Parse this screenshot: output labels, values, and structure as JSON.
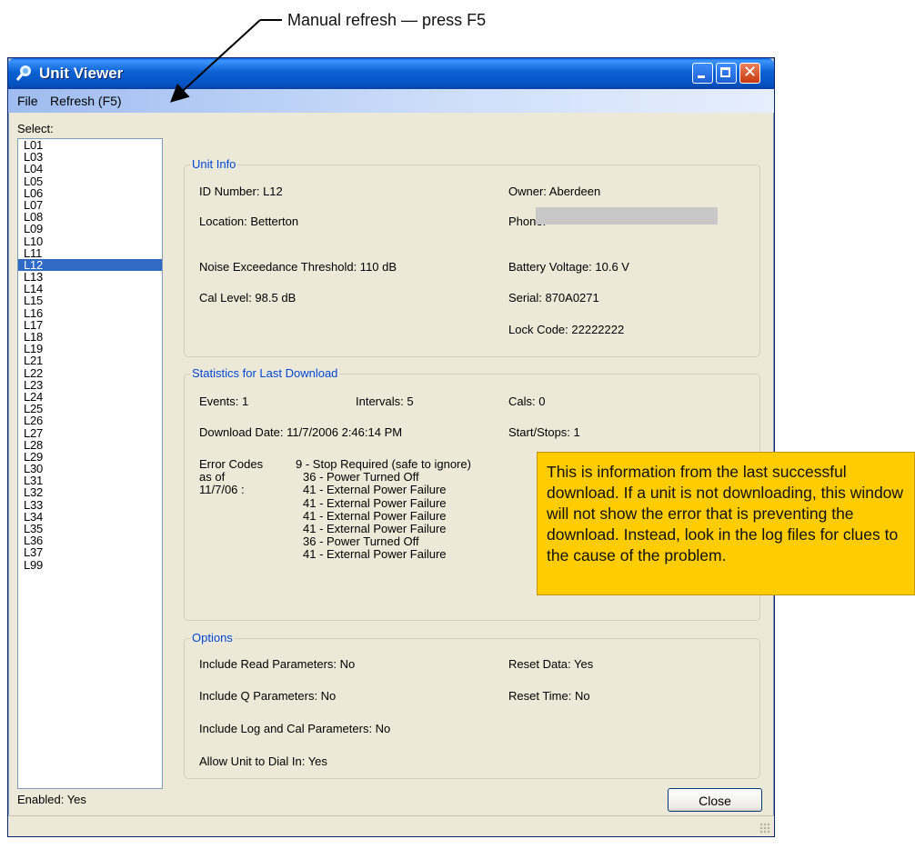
{
  "callout": {
    "text": "Manual refresh — press F5"
  },
  "window": {
    "title": "Unit Viewer"
  },
  "menu": {
    "file": "File",
    "refresh": "Refresh (F5)"
  },
  "select_label": "Select:",
  "units": [
    "L01",
    "L03",
    "L04",
    "L05",
    "L06",
    "L07",
    "L08",
    "L09",
    "L10",
    "L11",
    "L12",
    "L13",
    "L14",
    "L15",
    "L16",
    "L17",
    "L18",
    "L19",
    "L21",
    "L22",
    "L23",
    "L24",
    "L25",
    "L26",
    "L27",
    "L28",
    "L29",
    "L30",
    "L31",
    "L32",
    "L33",
    "L34",
    "L35",
    "L36",
    "L37",
    "L99"
  ],
  "selected_unit": "L12",
  "enabled": "Enabled: Yes",
  "unit_info": {
    "title": "Unit Info",
    "id_number": "ID Number: L12",
    "owner": "Owner: Aberdeen",
    "location": "Location: Betterton",
    "phone": "Phone:",
    "noise_threshold": "Noise Exceedance Threshold: 110 dB",
    "battery": "Battery Voltage: 10.6 V",
    "cal_level": "Cal Level: 98.5 dB",
    "serial": "Serial: 870A0271",
    "lock_code": "Lock Code: 22222222"
  },
  "stats": {
    "title": "Statistics for Last Download",
    "events": "Events: 1",
    "intervals": "Intervals: 5",
    "cals": "Cals: 0",
    "download_date": "Download Date: 11/7/2006 2:46:14 PM",
    "start_stops": "Start/Stops: 1",
    "error_codes_label": [
      "Error Codes",
      "as of",
      "11/7/06 :"
    ],
    "error_codes": [
      "9 - Stop Required (safe to ignore)",
      "36 - Power Turned Off",
      "41 - External Power Failure",
      "41 - External Power Failure",
      "41 - External Power Failure",
      "41 - External Power Failure",
      "36 - Power Turned Off",
      "41 - External Power Failure"
    ]
  },
  "options": {
    "title": "Options",
    "read_params": "Include Read Parameters: No",
    "reset_data": "Reset Data: Yes",
    "q_params": "Include Q Parameters: No",
    "reset_time": "Reset Time: No",
    "log_cal_params": "Include Log and Cal Parameters: No",
    "dial_in": "Allow Unit to Dial In: Yes"
  },
  "close_label": "Close",
  "note": "This is information from the last successful download. If a unit is not downloading, this window will not show the error that is preventing the download. Instead, look in the log files for clues to the cause of the problem."
}
